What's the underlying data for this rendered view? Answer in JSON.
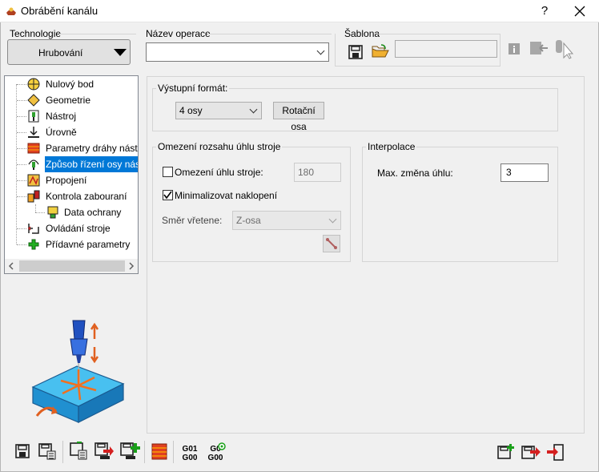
{
  "window": {
    "title": "Obrábění kanálu",
    "help_label": "?",
    "close_label": "✕"
  },
  "technologie": {
    "label": "Technologie",
    "value": "Hrubování"
  },
  "nazev_operace": {
    "label": "Název operace",
    "value": ""
  },
  "sablona": {
    "label": "Šablona",
    "value": ""
  },
  "tree": {
    "items": [
      {
        "label": "Nulový bod",
        "icon": "origin-icon"
      },
      {
        "label": "Geometrie",
        "icon": "geometry-icon"
      },
      {
        "label": "Nástroj",
        "icon": "tool-icon"
      },
      {
        "label": "Úrovně",
        "icon": "levels-icon"
      },
      {
        "label": "Parametry dráhy nástroje",
        "icon": "toolpath-params-icon"
      },
      {
        "label": "Způsob řízení osy nástroje",
        "icon": "tool-axis-icon"
      },
      {
        "label": "Propojení",
        "icon": "links-icon"
      },
      {
        "label": "Kontrola zabouraní",
        "icon": "collision-check-icon"
      },
      {
        "label": "Data ochrany",
        "icon": "protection-data-icon"
      },
      {
        "label": "Ovládání stroje",
        "icon": "machine-control-icon"
      },
      {
        "label": "Přídavné parametry",
        "icon": "additional-params-icon"
      }
    ]
  },
  "vystupni_format": {
    "legend": "Výstupní formát:",
    "axes_value": "4 osy",
    "rotary_button": "Rotační osa"
  },
  "omezeni": {
    "legend": "Omezení rozsahu úhlu stroje",
    "limit_label": "Omezení úhlu stroje:",
    "limit_value": "180",
    "limit_checked": false,
    "minimize_label": "Minimalizovat naklopení",
    "minimize_checked": true,
    "spindle_label": "Směr vřetene:",
    "spindle_value": "Z-osa"
  },
  "interpolace": {
    "legend": "Interpolace",
    "max_label": "Max. změna úhlu:",
    "max_value": "3"
  },
  "bottom": {
    "gcode1_top": "G01",
    "gcode1_bottom": "G00",
    "gcode2_top": "G0",
    "gcode2_bottom": "G00"
  },
  "colors": {
    "selection": "#0078d7",
    "accent_red": "#d42020",
    "accent_green": "#1aa01a",
    "accent_orange": "#f0a020"
  }
}
